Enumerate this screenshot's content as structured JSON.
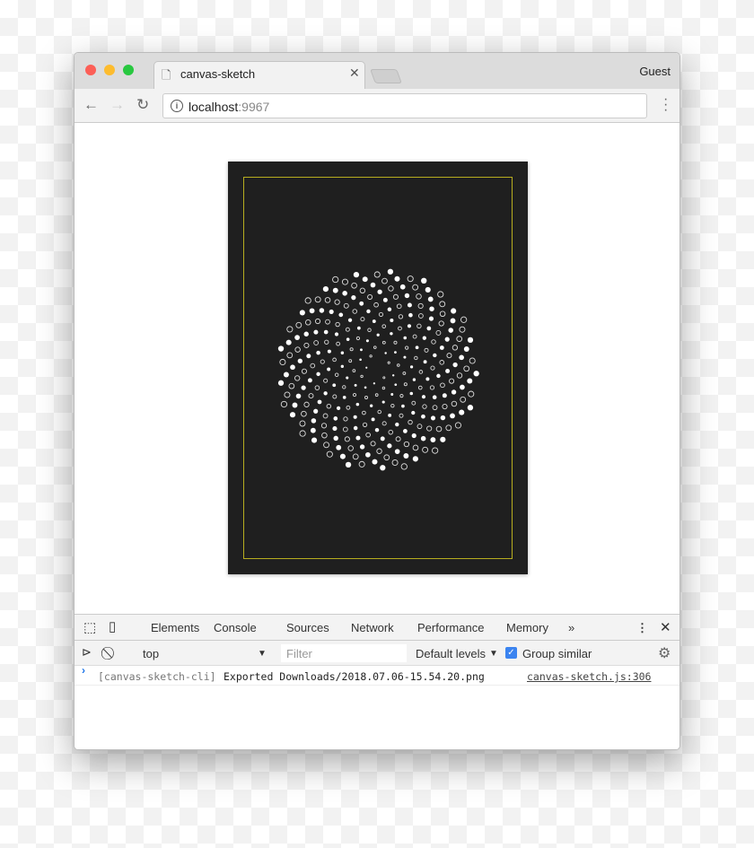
{
  "browser": {
    "tab_title": "canvas-sketch",
    "profile": "Guest",
    "url_host": "localhost",
    "url_port": ":9967"
  },
  "sketch": {
    "background": "#1f1f1f",
    "frame_color": "#b7ad1f",
    "dot_color": "#ffffff",
    "pattern": "phyllotaxis dots, alternating filled and ring"
  },
  "devtools": {
    "tabs": [
      "Elements",
      "Console",
      "Sources",
      "Network",
      "Performance",
      "Memory"
    ],
    "active_tab": "Console",
    "more": "»",
    "context": "top",
    "filter_placeholder": "Filter",
    "levels": "Default levels",
    "group_similar": "Group similar",
    "group_similar_checked": true,
    "log": {
      "prefix": "[canvas-sketch-cli]",
      "message": "Exported Downloads/2018.07.06-15.54.20.png",
      "source": "canvas-sketch.js:306"
    },
    "prompt": "›"
  }
}
